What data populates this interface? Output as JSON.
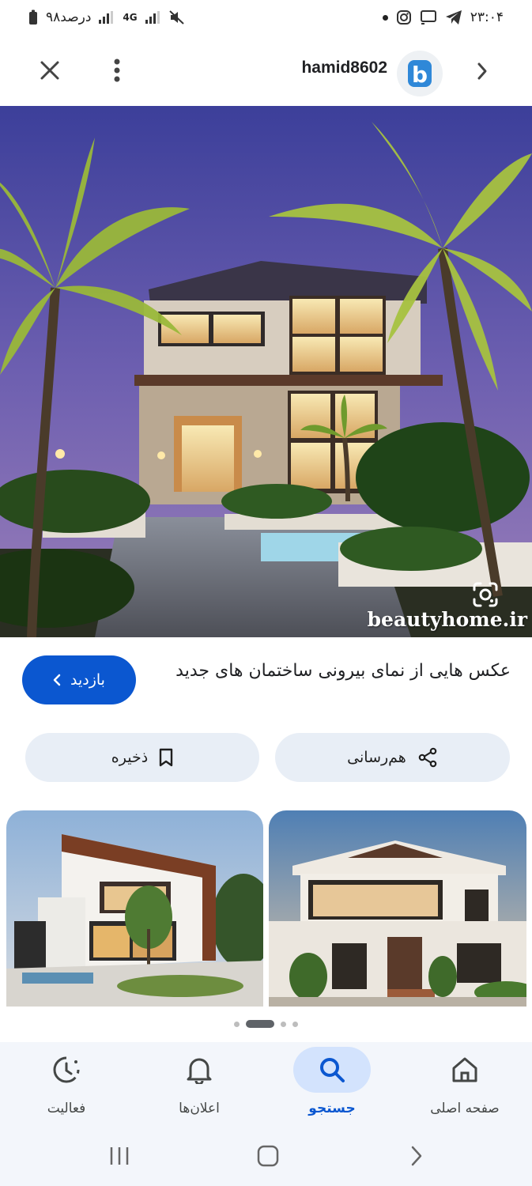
{
  "status_bar": {
    "time": "۲۳:۰۴",
    "battery": "۹۸درصد",
    "network": "4G"
  },
  "top_bar": {
    "site_name": "hamid8602",
    "logo_letter": "b"
  },
  "main_image": {
    "watermark": "beautyhome.ir"
  },
  "result": {
    "title": "عکس هایی از نمای بیرونی ساختمان های جدید",
    "visit_label": "بازدید"
  },
  "actions": {
    "save_label": "ذخیره",
    "share_label": "هم‌رسانی"
  },
  "carousel": {
    "page_count": 4,
    "active_index": 1
  },
  "bottom_nav": {
    "items": [
      {
        "label": "فعالیت",
        "icon": "activity-icon"
      },
      {
        "label": "اعلان‌ها",
        "icon": "bell-icon"
      },
      {
        "label": "جستجو",
        "icon": "search-icon",
        "active": true
      },
      {
        "label": "صفحه اصلی",
        "icon": "home-icon"
      }
    ]
  },
  "colors": {
    "accent": "#0b57d0",
    "chip_bg": "#e8eef6",
    "nav_bg": "#f3f6fb"
  }
}
